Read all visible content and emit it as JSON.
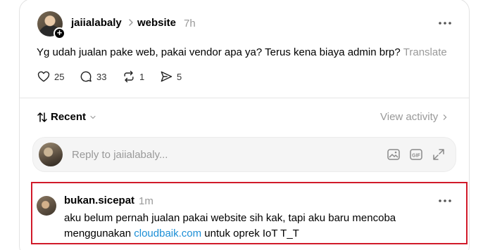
{
  "post": {
    "username": "jaiialabaly",
    "community": "website",
    "time": "7h",
    "text": "Yg udah jualan pake web, pakai vendor apa ya? Terus kena biaya admin brp?",
    "translate_label": "Translate",
    "likes": "25",
    "comments": "33",
    "reposts": "1",
    "shares": "5"
  },
  "thread": {
    "sort_label": "Recent",
    "view_activity_label": "View activity"
  },
  "reply_box": {
    "placeholder": "Reply to jaiialabaly..."
  },
  "comment": {
    "username": "bukan.sicepat",
    "time": "1m",
    "text_part1": "aku belum pernah jualan pakai website sih kak, tapi aku baru mencoba menggunakan ",
    "link_text": "cloudbaik.com",
    "text_part2": " untuk oprek IoT T_T"
  },
  "colors": {
    "link": "#1c8fd6",
    "highlight_border": "#d11a2a",
    "muted_text": "#999999"
  }
}
